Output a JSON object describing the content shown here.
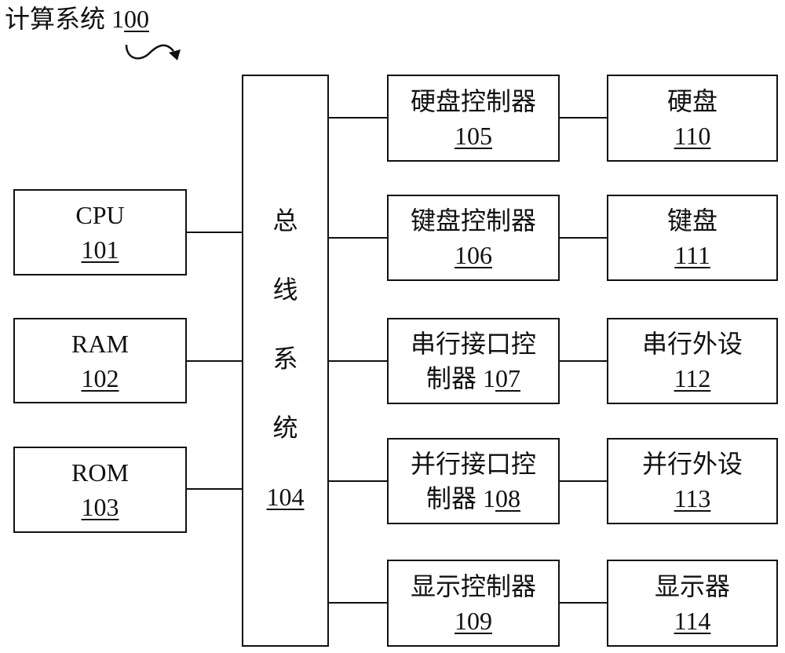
{
  "figure": {
    "title_prefix": "计算系统 1",
    "title_ref": "00",
    "arrow_icon": "curved-arrow"
  },
  "left": [
    {
      "label": "CPU",
      "ref": "101"
    },
    {
      "label": "RAM",
      "ref": "102"
    },
    {
      "label": "ROM",
      "ref": "103"
    }
  ],
  "bus": {
    "chars": [
      "总",
      "线",
      "系",
      "统"
    ],
    "ref": "104"
  },
  "controllers": [
    {
      "line1": "硬盘控制器",
      "ref_prefix": "",
      "ref": "105"
    },
    {
      "line1": "键盘控制器",
      "ref_prefix": "",
      "ref": "106"
    },
    {
      "line1": "串行接口控",
      "ref_prefix": "制器 1",
      "ref": "07"
    },
    {
      "line1": "并行接口控",
      "ref_prefix": "制器 1",
      "ref": "08"
    },
    {
      "line1": "显示控制器",
      "ref_prefix": "",
      "ref": "109"
    }
  ],
  "devices": [
    {
      "label": "硬盘",
      "ref": "110"
    },
    {
      "label": "键盘",
      "ref": "111"
    },
    {
      "label": "串行外设",
      "ref": "112"
    },
    {
      "label": "并行外设",
      "ref": "113"
    },
    {
      "label": "显示器",
      "ref": "114"
    }
  ]
}
